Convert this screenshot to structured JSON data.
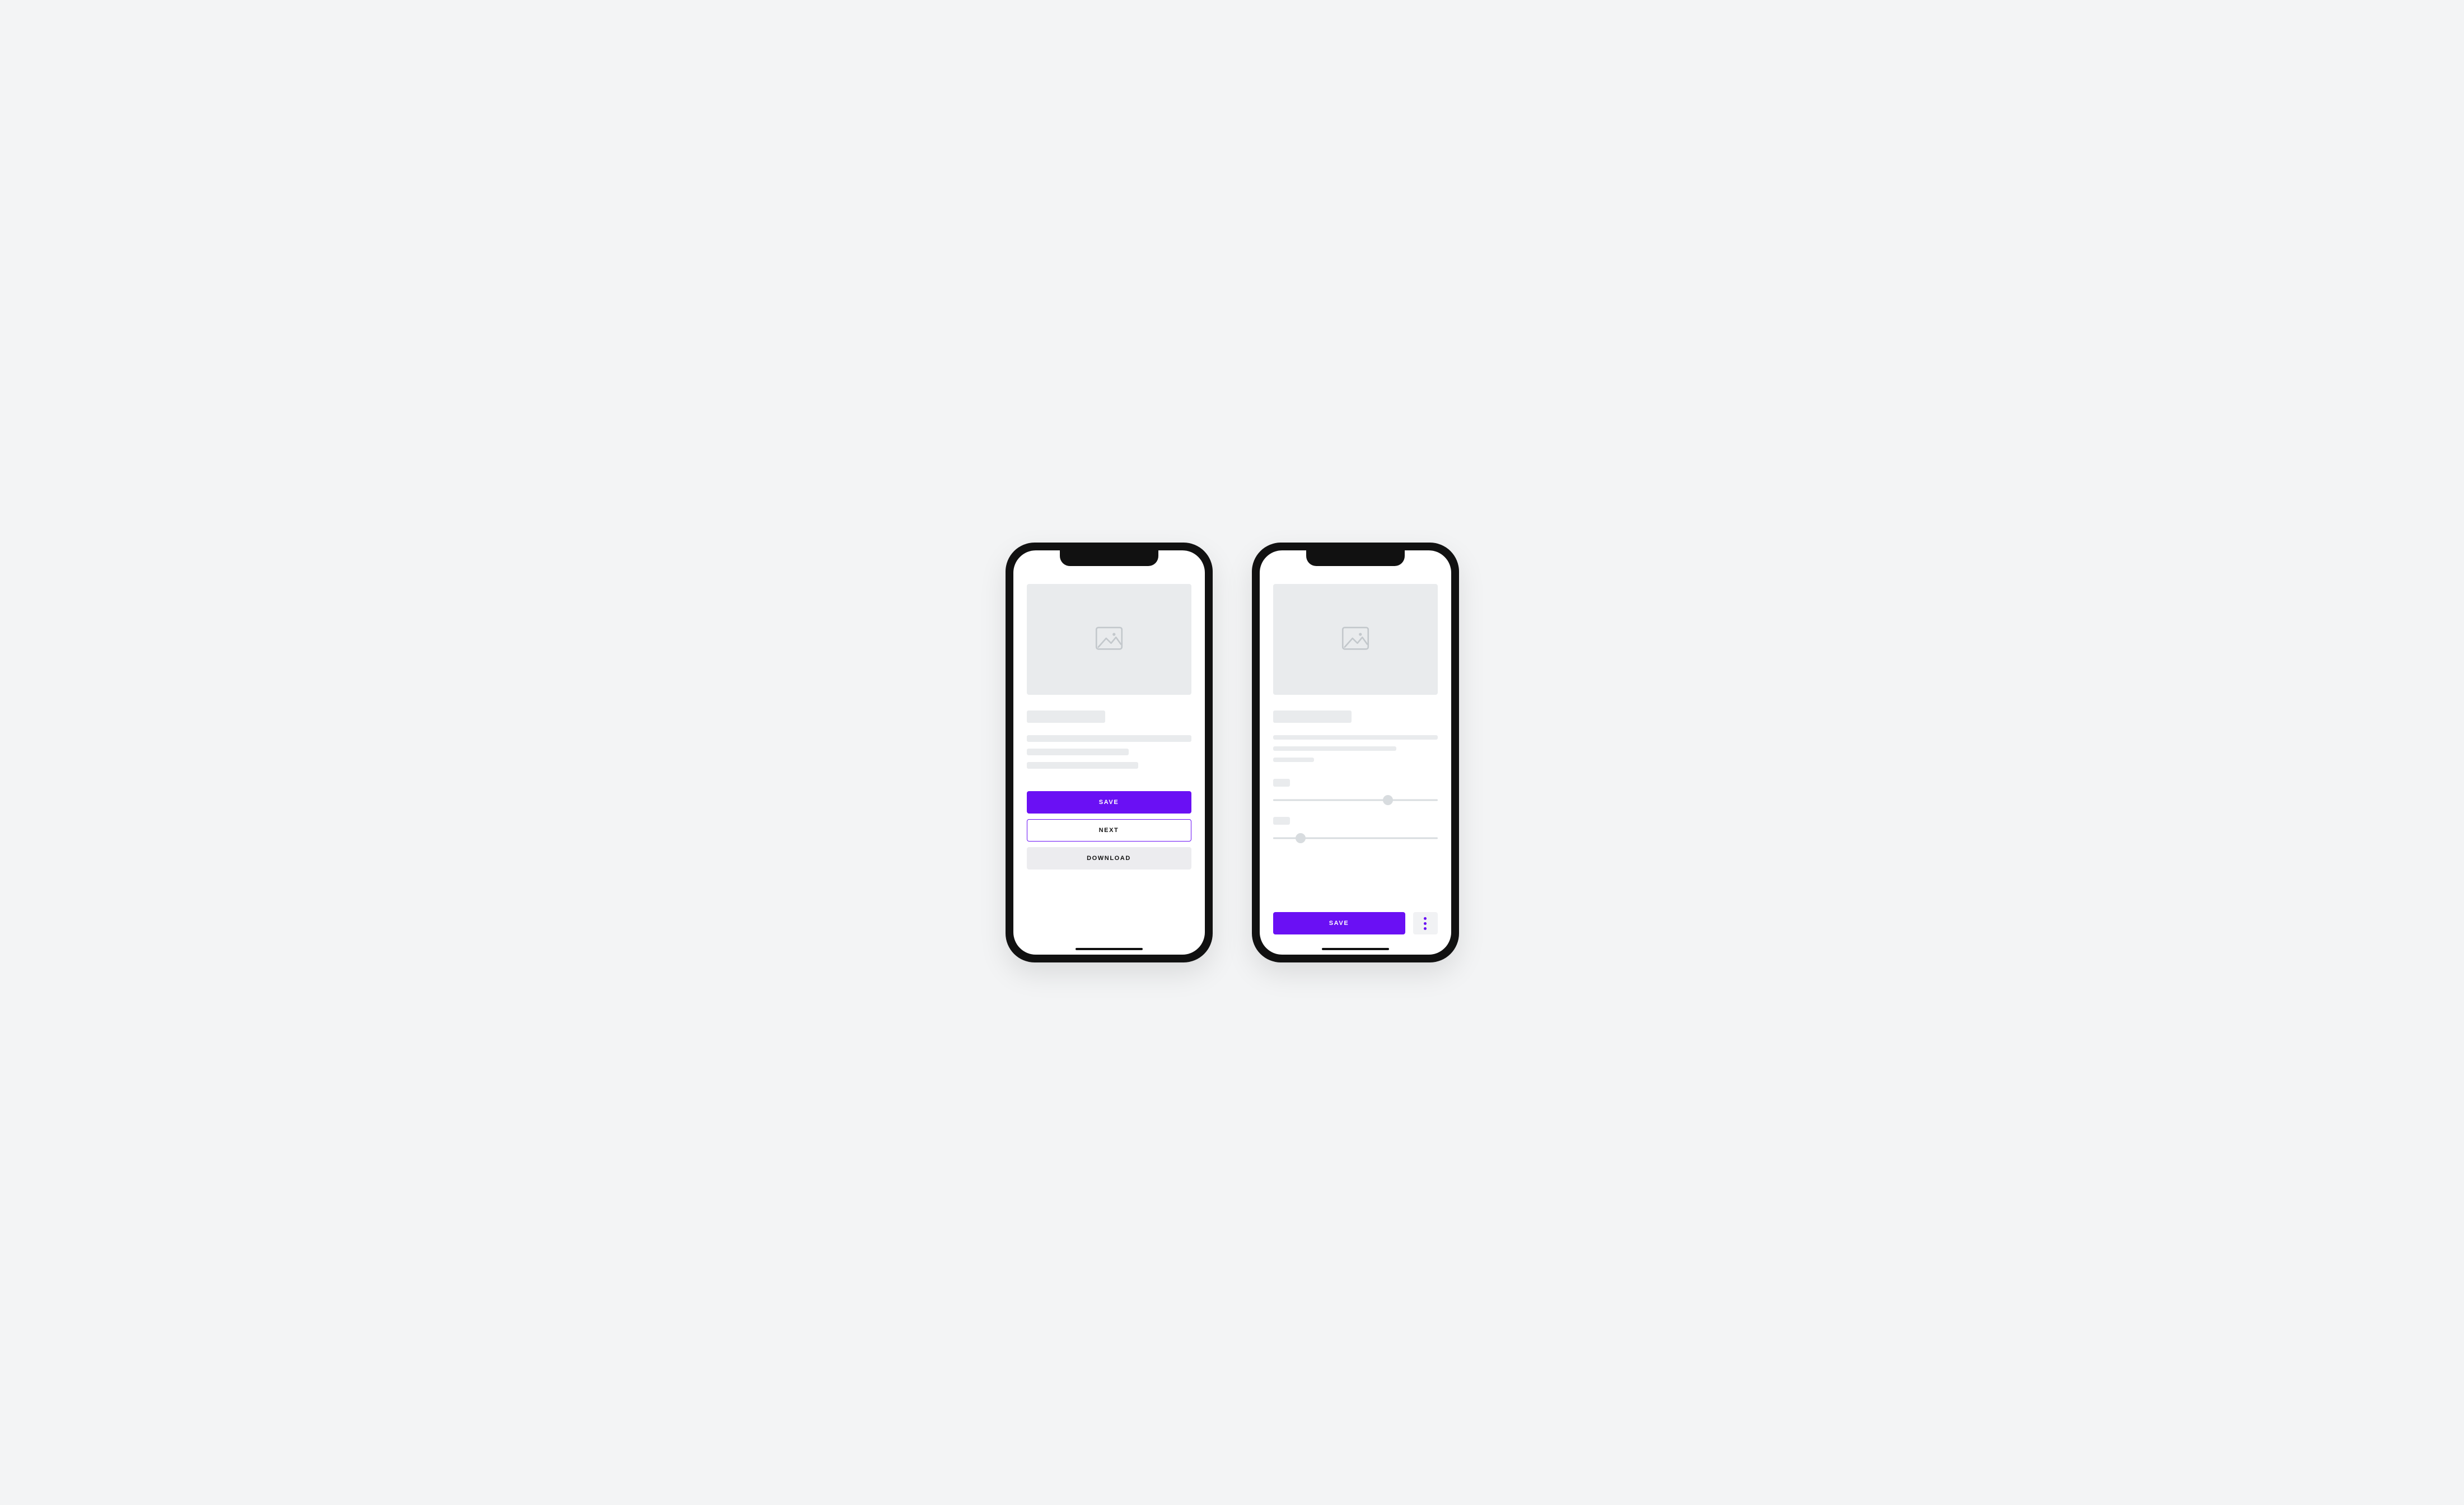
{
  "colors": {
    "accent": "#6a10f4",
    "placeholder": "#e9ebed",
    "muted_button": "#ececef"
  },
  "left_screen": {
    "hero_icon": "image-placeholder-icon",
    "buttons": {
      "primary_label": "SAVE",
      "outline_label": "NEXT",
      "muted_label": "DOWNLOAD"
    }
  },
  "right_screen": {
    "hero_icon": "image-placeholder-icon",
    "sliders": [
      {
        "value_percent": 70
      },
      {
        "value_percent": 17
      }
    ],
    "buttons": {
      "primary_label": "SAVE",
      "more_icon": "more-vertical-icon"
    }
  }
}
